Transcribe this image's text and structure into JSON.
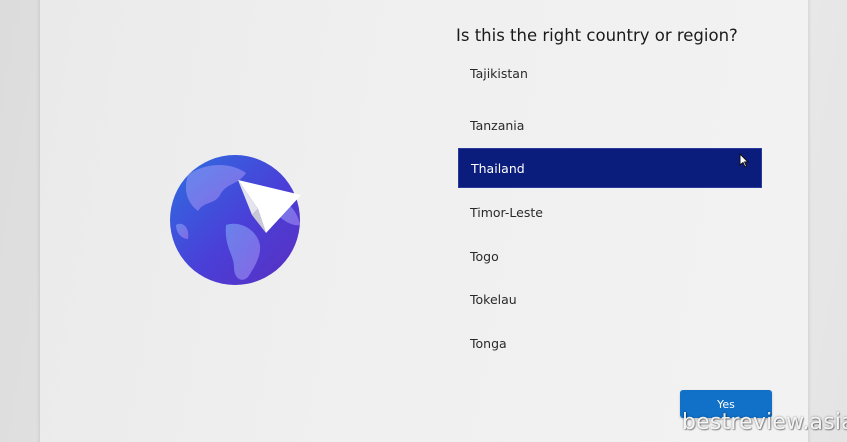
{
  "page": {
    "title": "Is this the right country or region?"
  },
  "region_list": {
    "items": [
      {
        "label": "Tajikistan",
        "selected": false
      },
      {
        "label": "Tanzania",
        "selected": false
      },
      {
        "label": "Thailand",
        "selected": true
      },
      {
        "label": "Timor-Leste",
        "selected": false
      },
      {
        "label": "Togo",
        "selected": false
      },
      {
        "label": "Tokelau",
        "selected": false
      },
      {
        "label": "Tonga",
        "selected": false
      }
    ]
  },
  "actions": {
    "yes_label": "Yes"
  },
  "watermark": {
    "text": "bestreview.asia"
  },
  "illustration": {
    "icon": "globe-paper-plane-icon"
  },
  "colors": {
    "selected_background": "#0b1d7c",
    "button_background": "#1170c8",
    "globe_primary": "#4b3fd6"
  }
}
